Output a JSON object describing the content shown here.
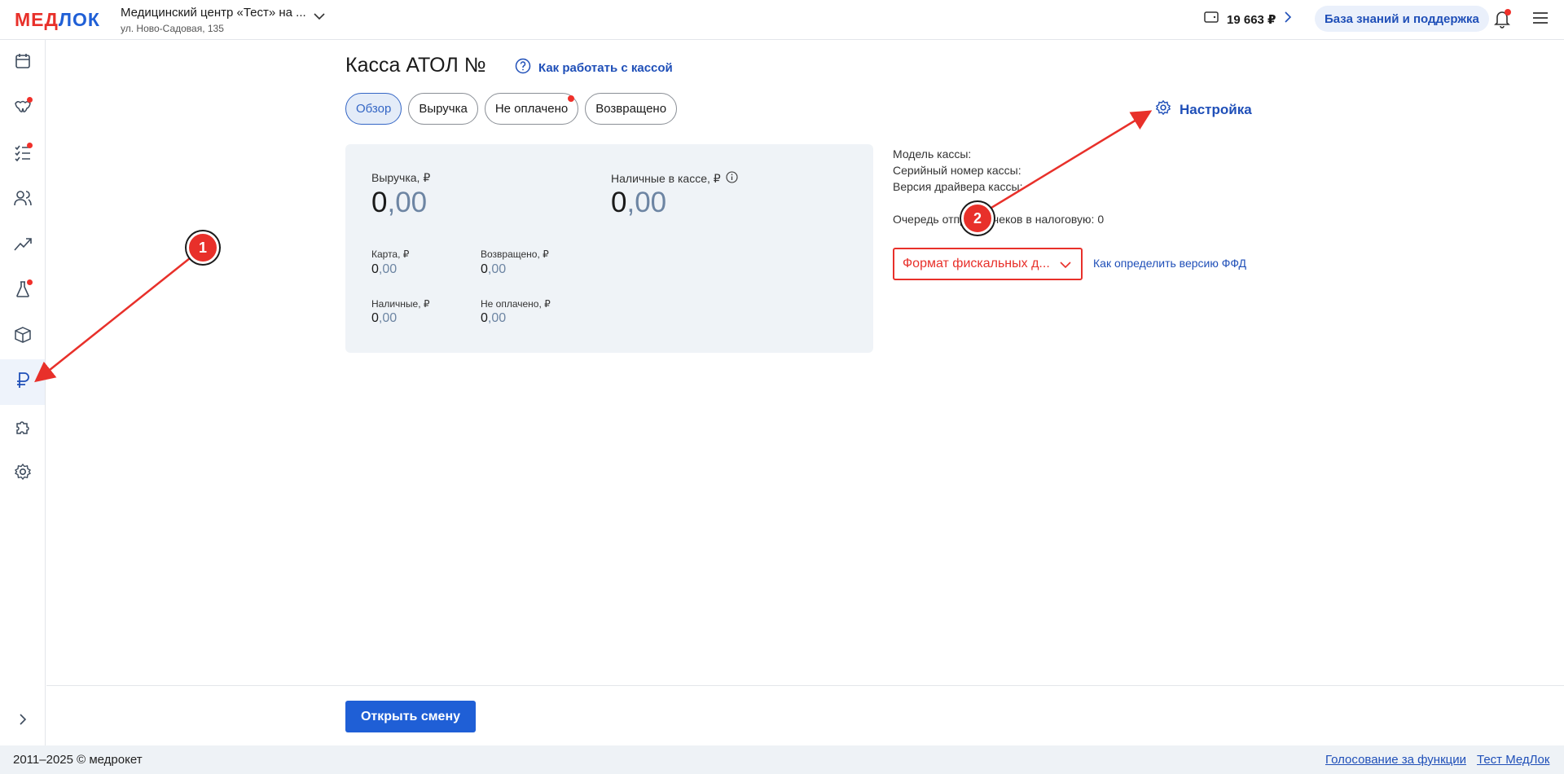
{
  "app": {
    "logo_left": "МЕД",
    "logo_right": "ЛОК"
  },
  "header": {
    "clinic_name": "Медицинский центр «Тест» на ...",
    "clinic_address": "ул. Ново-Садовая, 135",
    "balance": "19 663 ₽",
    "support_label": "База знаний и поддержка"
  },
  "sidebar": {
    "items": [
      {
        "icon": "calendar-icon",
        "badge": false
      },
      {
        "icon": "teeth-icon",
        "badge": true
      },
      {
        "icon": "checklist-icon",
        "badge": true
      },
      {
        "icon": "users-icon",
        "badge": false
      },
      {
        "icon": "chart-icon",
        "badge": false
      },
      {
        "icon": "flask-icon",
        "badge": true
      },
      {
        "icon": "box-icon",
        "badge": false
      },
      {
        "icon": "ruble-icon",
        "badge": false,
        "active": true
      },
      {
        "icon": "puzzle-icon",
        "badge": false
      },
      {
        "icon": "gear-icon",
        "badge": false
      }
    ]
  },
  "main": {
    "title": "Касса АТОЛ №",
    "help_link": "Как работать с кассой",
    "tabs": [
      {
        "label": "Обзор",
        "active": true
      },
      {
        "label": "Выручка"
      },
      {
        "label": "Не оплачено",
        "badge": true
      },
      {
        "label": "Возвращено"
      }
    ],
    "settings_link": "Настройка",
    "stats": {
      "revenue_label": "Выручка, ₽",
      "revenue_int": "0",
      "revenue_dec": ",00",
      "cash_in_register_label": "Наличные в кассе, ₽",
      "cash_in_register_int": "0",
      "cash_in_register_dec": ",00",
      "card_label": "Карта, ₽",
      "card_int": "0",
      "card_dec": ",00",
      "returned_label": "Возвращено, ₽",
      "returned_int": "0",
      "returned_dec": ",00",
      "cash_label": "Наличные, ₽",
      "cash_int": "0",
      "cash_dec": ",00",
      "unpaid_label": "Не оплачено, ₽",
      "unpaid_int": "0",
      "unpaid_dec": ",00"
    },
    "info": {
      "model": "Модель кассы:",
      "serial": "Серийный номер кассы:",
      "driver": "Версия драйвера кассы:",
      "queue": "Очередь отправки чеков в налоговую: 0"
    },
    "ffd_select": "Формат фискальных д...",
    "ffd_link": "Как определить версию ФФД"
  },
  "actions": {
    "open_shift": "Открыть смену"
  },
  "footer": {
    "copyright": "2011–2025 © медрокет",
    "link_vote": "Голосование за функции",
    "link_test": "Тест МедЛок"
  },
  "annotations": {
    "marker1": "1",
    "marker2": "2",
    "color": "#e8302a"
  }
}
